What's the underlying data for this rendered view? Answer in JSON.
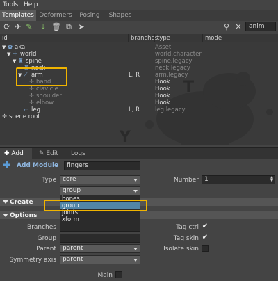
{
  "menu": {
    "items": [
      "Tools",
      "Help"
    ]
  },
  "tabs": [
    "Templates",
    "Deformers",
    "Posing",
    "Shapes"
  ],
  "toolbar": {
    "anim_value": "anim",
    "icons": [
      "refresh-icon",
      "rocket-icon",
      "brush-icon",
      "import-icon",
      "delete-icon",
      "duplicate-icon",
      "select-icon"
    ]
  },
  "tree": {
    "columns": [
      "id",
      "branches",
      "type",
      "mode"
    ],
    "rows": [
      {
        "id": "aka",
        "branches": "",
        "type": "Asset",
        "type_style": "gray",
        "id_style": "normal"
      },
      {
        "id": "world",
        "branches": "",
        "type": "world.character",
        "type_style": "gray",
        "id_style": "normal"
      },
      {
        "id": "spine",
        "branches": "",
        "type": "spine.legacy",
        "type_style": "gray",
        "id_style": "normal"
      },
      {
        "id": "neck",
        "branches": "",
        "type": "neck.legacy",
        "type_style": "gray",
        "id_style": "normal"
      },
      {
        "id": "arm",
        "branches": "L, R",
        "type": "arm.legacy",
        "type_style": "gray",
        "id_style": "normal"
      },
      {
        "id": "hand",
        "branches": "",
        "type": "Hook",
        "type_style": "normal",
        "id_style": "gray"
      },
      {
        "id": "clavicle",
        "branches": "",
        "type": "Hook",
        "type_style": "normal",
        "id_style": "gray"
      },
      {
        "id": "shoulder",
        "branches": "",
        "type": "Hook",
        "type_style": "normal",
        "id_style": "gray"
      },
      {
        "id": "elbow",
        "branches": "",
        "type": "Hook",
        "type_style": "normal",
        "id_style": "gray"
      },
      {
        "id": "leg",
        "branches": "L, R",
        "type": "leg.legacy",
        "type_style": "gray",
        "id_style": "normal"
      },
      {
        "id": "scene root",
        "branches": "",
        "type": "",
        "type_style": "gray",
        "id_style": "normal"
      }
    ],
    "watermark_letters": [
      "T",
      "Y"
    ]
  },
  "dock": {
    "tabs": [
      "Add",
      "Edit",
      "Logs"
    ]
  },
  "add_module": {
    "label": "Add Module",
    "value": "fingers",
    "type_label": "Type",
    "type_value": "core",
    "template_value": "group",
    "number_label": "Number",
    "number_value": "1"
  },
  "create": {
    "label": "Create"
  },
  "dropdown": {
    "options": [
      "bones",
      "group",
      "joints",
      "xform"
    ],
    "selected": "group"
  },
  "options": {
    "label": "Options",
    "branches_label": "Branches",
    "branches_value": "",
    "group_label": "Group",
    "group_value": "",
    "parent_label": "Parent",
    "parent_value": "parent",
    "symmetry_label": "Symmetry axis",
    "symmetry_value": "parent",
    "tag_ctrl_label": "Tag ctrl",
    "tag_ctrl_checked": true,
    "tag_skin_label": "Tag skin",
    "tag_skin_checked": true,
    "isolate_skin_label": "Isolate skin",
    "isolate_skin_checked": false,
    "main_label": "Main",
    "main_checked": false
  },
  "colors": {
    "accent": "#5285a6",
    "highlight": "#f0b400",
    "panel": "#444444"
  }
}
